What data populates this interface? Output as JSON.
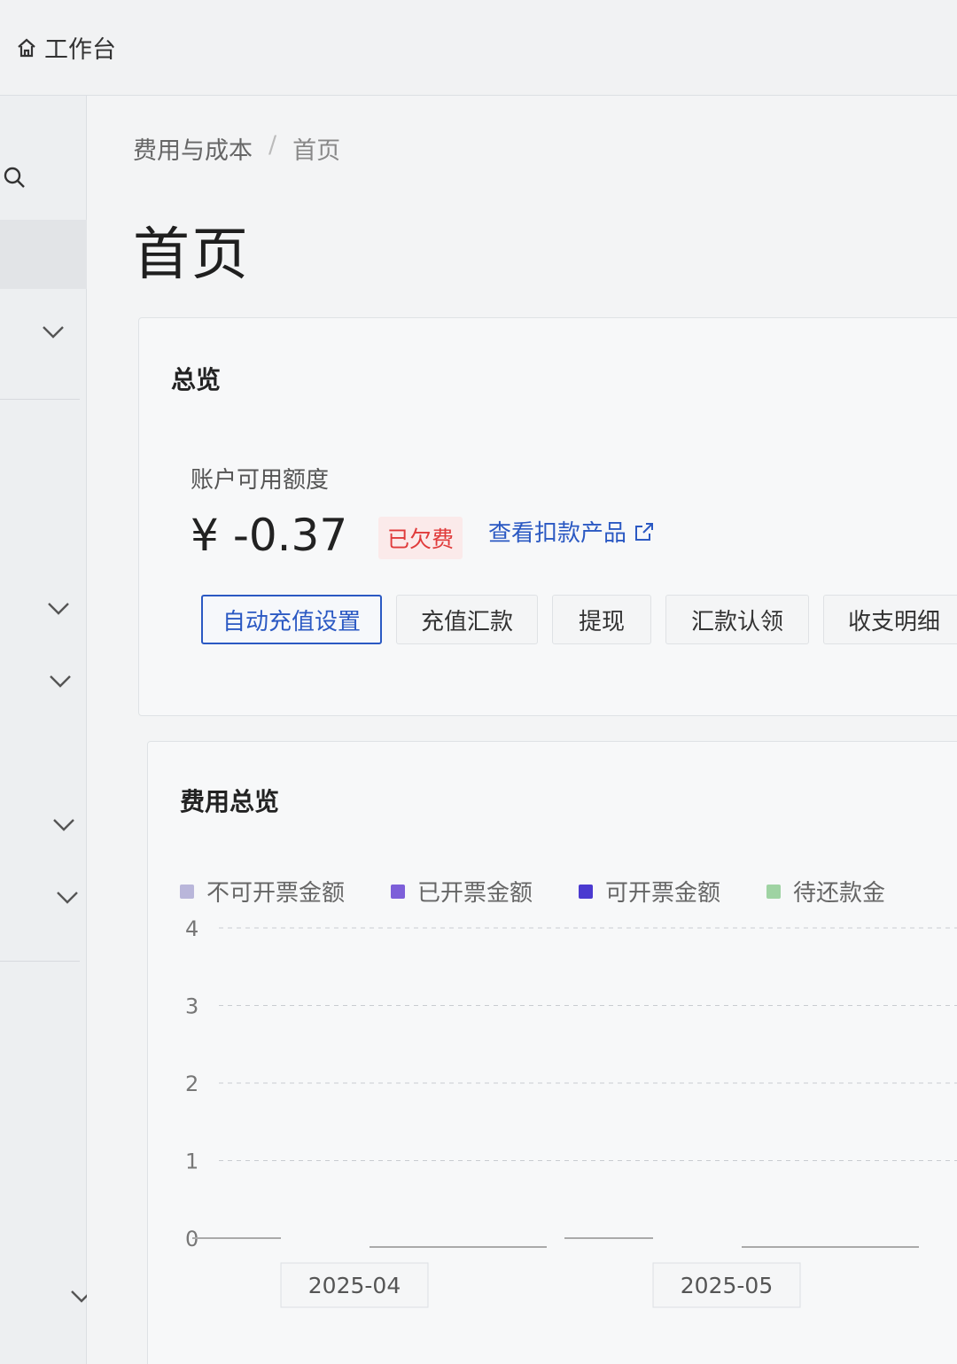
{
  "topbar": {
    "home_label": "工作台"
  },
  "breadcrumb": {
    "parent": "费用与成本",
    "separator": "/",
    "current": "首页"
  },
  "page_title": "首页",
  "overview": {
    "title": "总览",
    "account_label": "账户可用额度",
    "currency": "¥",
    "amount": "-0.37",
    "status_badge": "已欠费",
    "link_label": "查看扣款产品",
    "buttons": [
      "自动充值设置",
      "充值汇款",
      "提现",
      "汇款认领",
      "收支明细"
    ]
  },
  "cost_overview": {
    "title": "费用总览"
  },
  "chart_data": {
    "type": "bar",
    "categories": [
      "2025-04",
      "2025-05"
    ],
    "series": [
      {
        "name": "不可开票金额",
        "values": [
          0,
          0
        ],
        "color": "#b9b6da"
      },
      {
        "name": "已开票金额",
        "values": [
          0,
          0
        ],
        "color": "#7d5fd9"
      },
      {
        "name": "可开票金额",
        "values": [
          0,
          0
        ],
        "color": "#4b3ad0"
      },
      {
        "name": "待还款金",
        "values": [
          0,
          0
        ],
        "color": "#9fd3a3"
      }
    ],
    "yticks": [
      0,
      1,
      2,
      3,
      4
    ],
    "ylim": [
      0,
      4
    ],
    "grid": true,
    "legend_position": "top-left"
  },
  "colors": {
    "accent": "#2b59c3",
    "danger": "#e03b3b"
  }
}
